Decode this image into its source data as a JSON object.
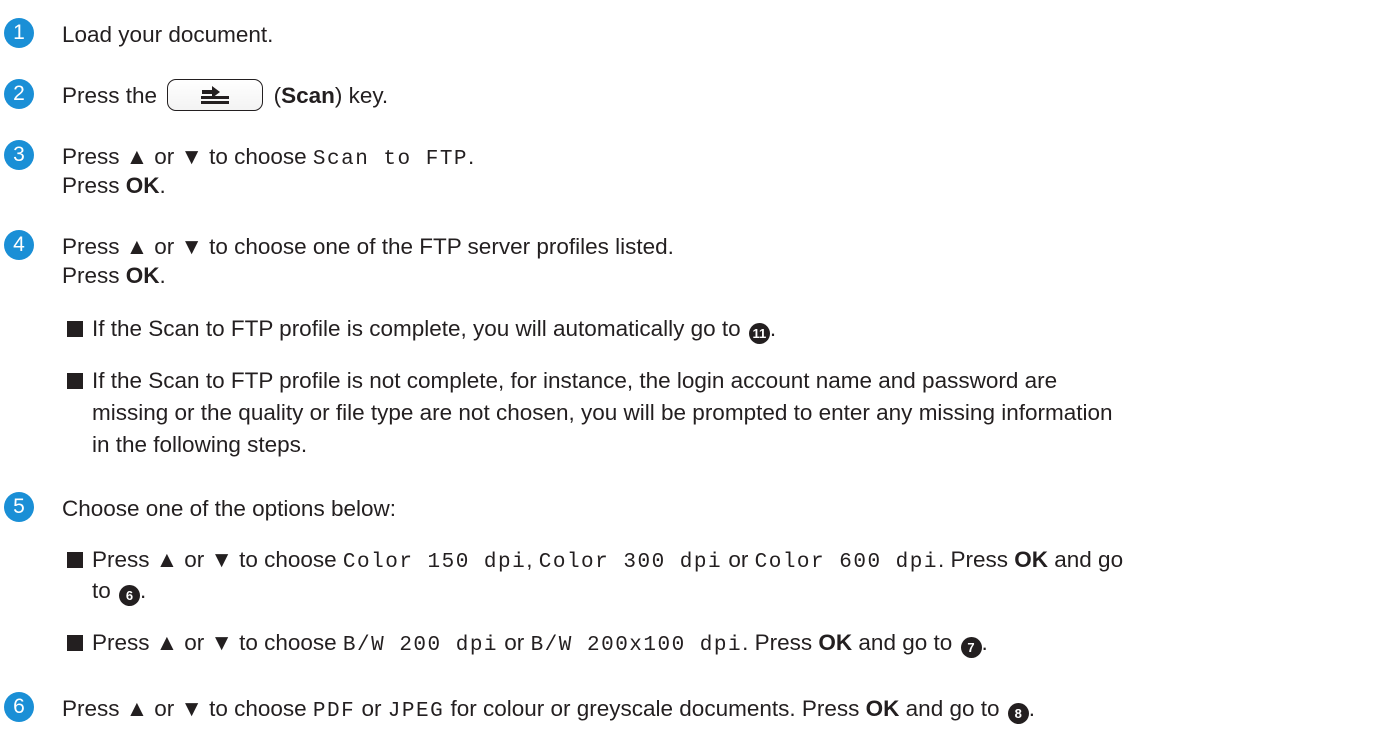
{
  "steps": {
    "s1": {
      "num": "1",
      "text": "Load your document."
    },
    "s2": {
      "num": "2",
      "pre": "Press the",
      "key_label": "Scan",
      "post": "key."
    },
    "s3": {
      "num": "3",
      "line1_pre": "Press ▲ or ▼ to choose",
      "line1_code": "Scan to FTP",
      "line2_pre": "Press",
      "line2_bold": "OK"
    },
    "s4": {
      "num": "4",
      "line1": "Press ▲ or ▼ to choose one of the FTP server profiles listed.",
      "line2_pre": "Press",
      "line2_bold": "OK",
      "bullet1": "If the Scan to FTP profile is complete, you will automatically go to",
      "bullet1_ref": "11",
      "bullet2_l1": "If the Scan to FTP profile is not complete, for instance, the login account name and password are",
      "bullet2_l2": "missing or the quality or file type are not chosen, you will be prompted to enter any missing information",
      "bullet2_l3": "in the following steps."
    },
    "s5": {
      "num": "5",
      "text": "Choose one of the options below:",
      "b1_pre": "Press ▲ or ▼ to choose",
      "b1_code1": "Color 150 dpi",
      "b1_code2": "Color 300 dpi",
      "b1_or": "or",
      "b1_code3": "Color 600 dpi",
      "b1_press": "Press",
      "b1_ok": "OK",
      "b1_goto": "and go",
      "b1_to": "to",
      "b1_ref": "6",
      "b2_pre": "Press ▲ or ▼ to choose",
      "b2_code1": "B/W 200 dpi",
      "b2_or": "or",
      "b2_code2": "B/W 200x100 dpi",
      "b2_press": "Press",
      "b2_ok": "OK",
      "b2_goto": "and go to",
      "b2_ref": "7"
    },
    "s6": {
      "num": "6",
      "pre": "Press ▲ or ▼ to choose",
      "code1": "PDF",
      "or": "or",
      "code2": "JPEG",
      "mid": "for colour or greyscale documents. Press",
      "ok": "OK",
      "goto": "and go to",
      "ref": "8"
    }
  },
  "colors": {
    "badge": "#1a8fd6",
    "text": "#231f20"
  },
  "icons": {
    "scan_key": "scan-key-icon",
    "bullet": "square-bullet-icon"
  }
}
